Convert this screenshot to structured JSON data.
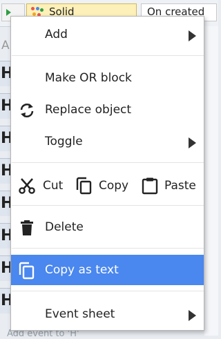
{
  "background": {
    "toolbar_solid_label": "Solid",
    "toolbar_created_label": "On created",
    "left_column_letters": [
      "H",
      "H",
      "H",
      "H",
      "H",
      "H",
      "H",
      "H"
    ],
    "partial_letter": "A",
    "bottom_partial_text": "Add event to 'H'"
  },
  "menu": {
    "add": {
      "label": "Add",
      "icon": "none",
      "has_submenu": true
    },
    "make_or_block": {
      "label": "Make OR block",
      "icon": "none"
    },
    "replace_object": {
      "label": "Replace object",
      "icon": "sync-icon"
    },
    "toggle": {
      "label": "Toggle",
      "icon": "none",
      "has_submenu": true
    },
    "cut": {
      "label": "Cut",
      "icon": "scissors-icon"
    },
    "copy": {
      "label": "Copy",
      "icon": "copy-icon"
    },
    "paste": {
      "label": "Paste",
      "icon": "clipboard-icon"
    },
    "delete": {
      "label": "Delete",
      "icon": "trash-icon"
    },
    "copy_as_text": {
      "label": "Copy as text",
      "icon": "copy-icon",
      "highlighted": true
    },
    "event_sheet": {
      "label": "Event sheet",
      "icon": "none",
      "has_submenu": true
    }
  },
  "colors": {
    "highlight": "#4a87ee",
    "highlight_text": "#ffffff",
    "menu_background": "#ffffff",
    "solid_button": "#fdf0b8"
  }
}
